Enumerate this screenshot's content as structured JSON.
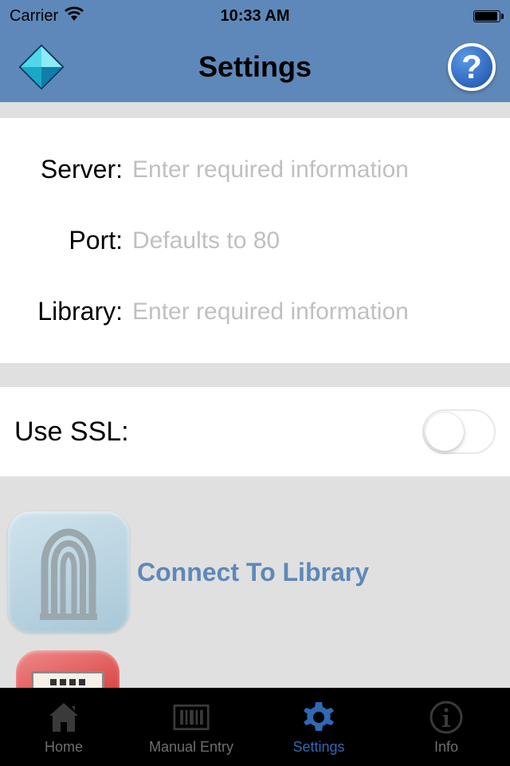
{
  "status_bar": {
    "carrier": "Carrier",
    "time": "10:33 AM"
  },
  "nav": {
    "title": "Settings"
  },
  "form": {
    "server": {
      "label": "Server:",
      "placeholder": "Enter required information",
      "value": ""
    },
    "port": {
      "label": "Port:",
      "placeholder": "Defaults to 80",
      "value": ""
    },
    "library": {
      "label": "Library:",
      "placeholder": "Enter required information",
      "value": ""
    }
  },
  "ssl": {
    "label": "Use SSL:",
    "value": false
  },
  "connect": {
    "label": "Connect To Library"
  },
  "tabs": {
    "home": "Home",
    "manual": "Manual Entry",
    "settings": "Settings",
    "info": "Info",
    "active": "settings"
  },
  "colors": {
    "header": "#5e88b9",
    "accent": "#2f68b5"
  }
}
